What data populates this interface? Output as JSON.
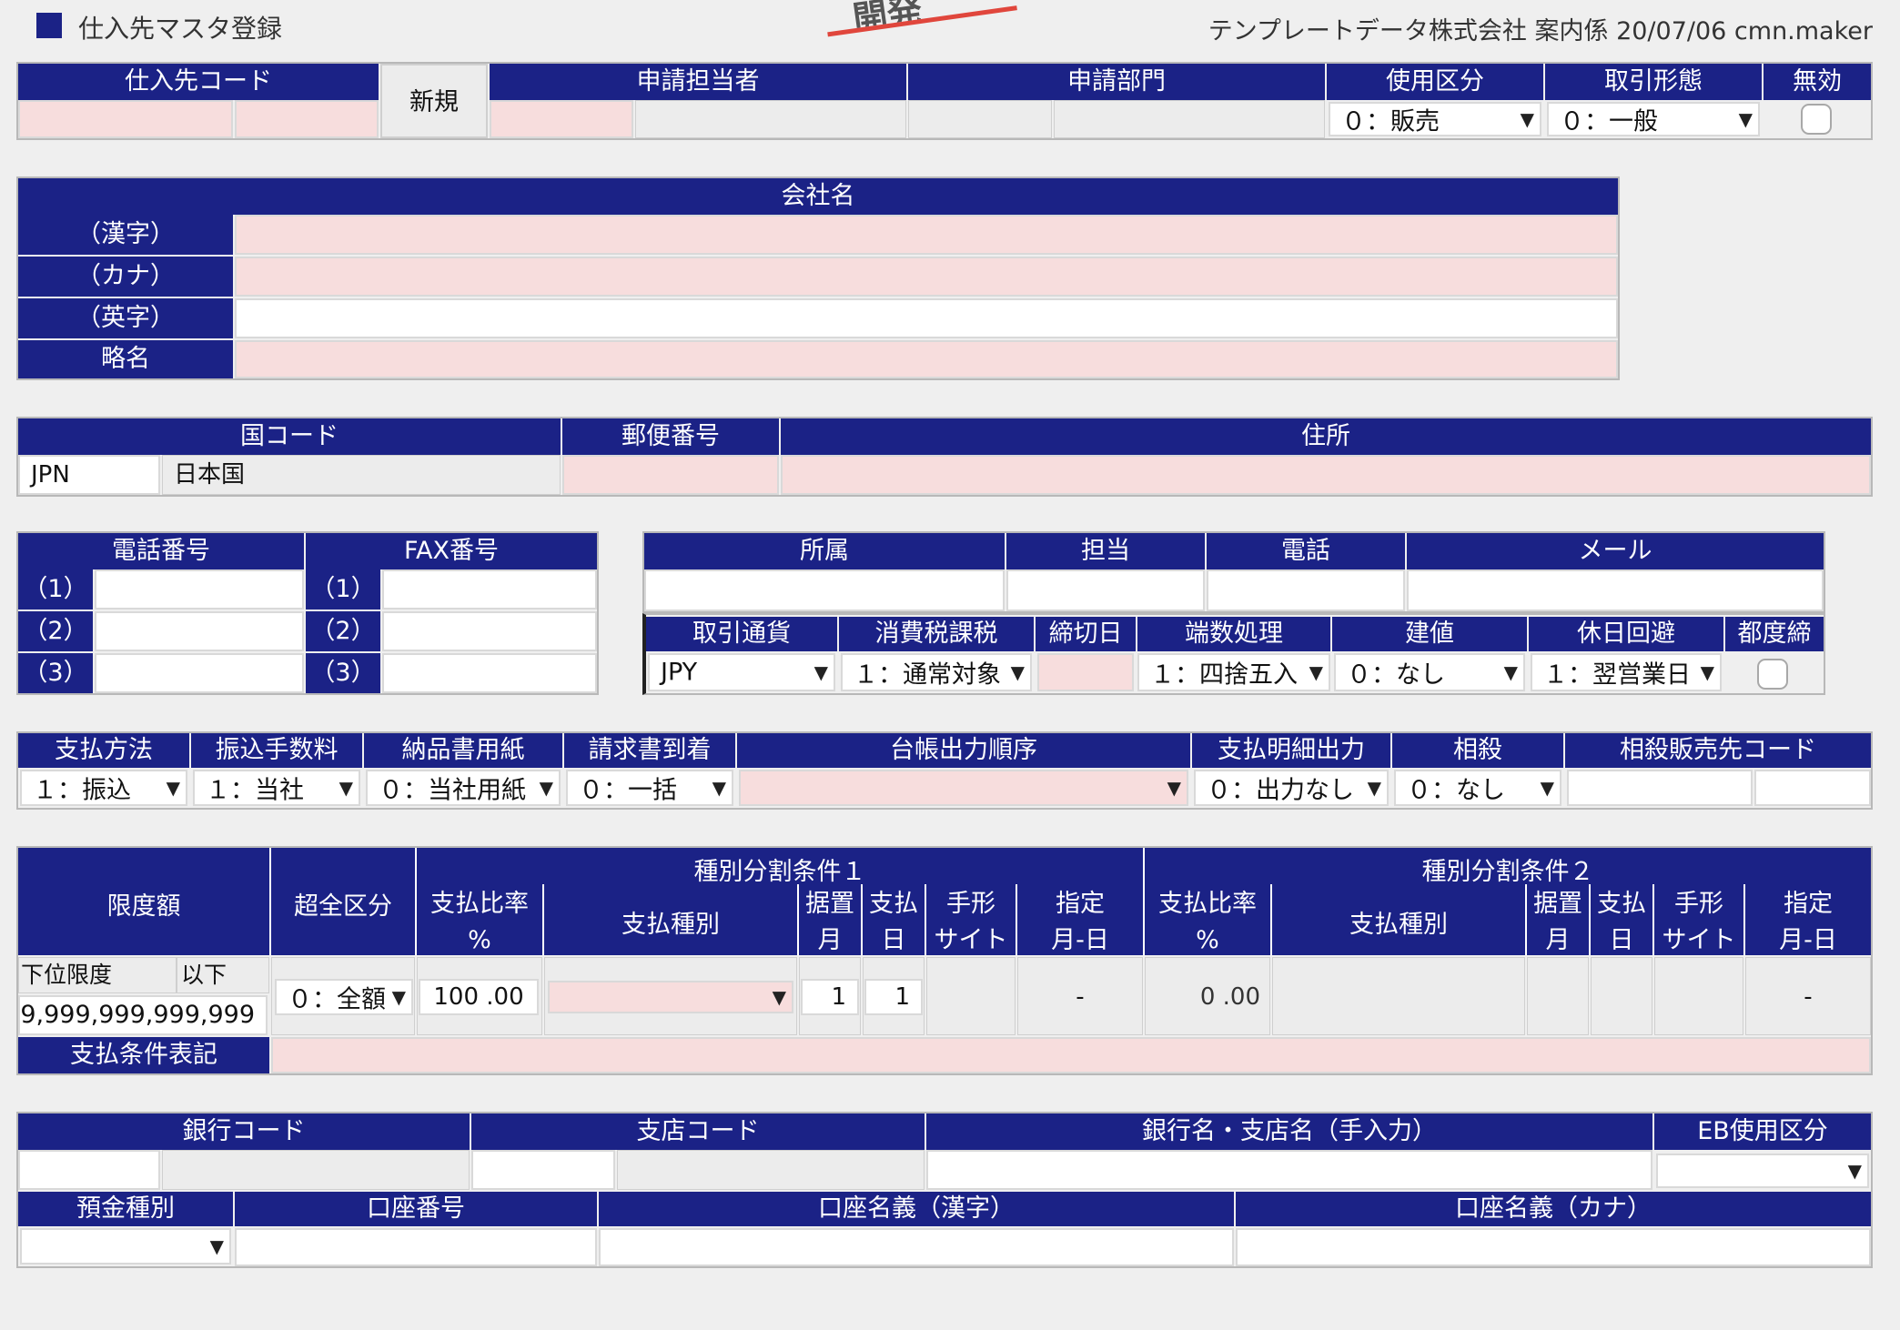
{
  "header": {
    "title": "仕入先マスタ登録",
    "stamp": "開発",
    "user_info": "テンプレートデータ株式会社 案内係 20/07/06 cmn.maker"
  },
  "row1": {
    "supplier_code": "仕入先コード",
    "new_button": "新規",
    "applicant": "申請担当者",
    "dept": "申請部門",
    "usage": "使用区分",
    "usage_value": "０：販売",
    "trade_type": "取引形態",
    "trade_type_value": "０：一般",
    "invalid": "無効"
  },
  "company": {
    "header": "会社名",
    "kanji": "（漢字）",
    "kana": "（カナ）",
    "english": "（英字）",
    "short": "略名"
  },
  "address": {
    "country_code": "国コード",
    "country_code_value": "JPN",
    "country_name": "日本国",
    "postal": "郵便番号",
    "address": "住所"
  },
  "phone": {
    "tel": "電話番号",
    "fax": "FAX番号",
    "n1": "（1）",
    "n2": "（2）",
    "n3": "（3）"
  },
  "contact": {
    "affiliation": "所属",
    "person": "担当",
    "tel": "電話",
    "mail": "メール"
  },
  "terms": {
    "currency": "取引通貨",
    "currency_value": "JPY",
    "tax": "消費税課税",
    "tax_value": "１：通常対象",
    "closing": "締切日",
    "rounding": "端数処理",
    "rounding_value": "１：四捨五入",
    "basis": "建値",
    "basis_value": "０：なし",
    "holiday": "休日回避",
    "holiday_value": "１：翌営業日",
    "each": "都度締"
  },
  "payment": {
    "method": "支払方法",
    "method_value": "１：振込",
    "fee": "振込手数料",
    "fee_value": "１：当社",
    "paper": "納品書用紙",
    "paper_value": "０：当社用紙",
    "invoice": "請求書到着",
    "invoice_value": "０：一括",
    "ledger": "台帳出力順序",
    "detail": "支払明細出力",
    "detail_value": "０：出力なし",
    "offset": "相殺",
    "offset_value": "０：なし",
    "offset_code": "相殺販売先コード"
  },
  "limits": {
    "limit": "限度額",
    "over": "超全区分",
    "cond1": "種別分割条件１",
    "cond2": "種別分割条件２",
    "ratio": "支払比率",
    "pct": "%",
    "type": "支払種別",
    "defer": "据置",
    "month": "月",
    "pay": "支払",
    "day": "日",
    "bill": "手形",
    "site": "サイト",
    "spec": "指定",
    "md": "月-日",
    "lower": "下位限度",
    "below": "以下",
    "amount": "9,999,999,999,999",
    "over_value": "０：全額",
    "ratio1": "100 .00",
    "defer1": "1",
    "pay1": "1",
    "dash": "-",
    "ratio2": "0 .00",
    "notation": "支払条件表記"
  },
  "bank": {
    "bank_code": "銀行コード",
    "branch_code": "支店コード",
    "bank_name": "銀行名・支店名（手入力）",
    "eb": "EB使用区分",
    "deposit": "預金種別",
    "account_no": "口座番号",
    "holder_kanji": "口座名義（漢字）",
    "holder_kana": "口座名義（カナ）"
  },
  "colors": {
    "header_bg": "#1b2286",
    "required_bg": "#f7dddd",
    "page_bg": "#efefef",
    "stamp": "#e0463c"
  }
}
